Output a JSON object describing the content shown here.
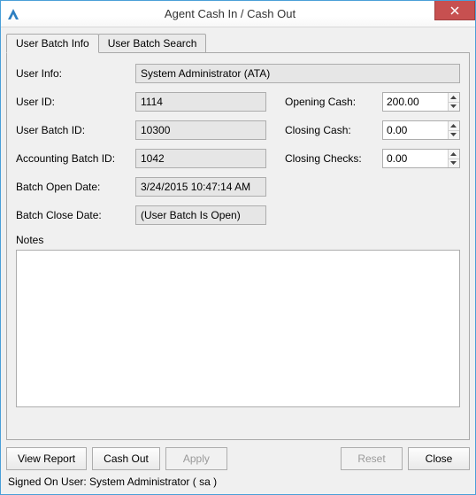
{
  "window": {
    "title": "Agent Cash In / Cash Out"
  },
  "tabs": {
    "info": "User Batch Info",
    "search": "User Batch Search"
  },
  "labels": {
    "userInfo": "User Info:",
    "userId": "User ID:",
    "userBatchId": "User Batch ID:",
    "acctBatchId": "Accounting Batch ID:",
    "batchOpen": "Batch Open Date:",
    "batchClose": "Batch Close Date:",
    "openingCash": "Opening Cash:",
    "closingCash": "Closing Cash:",
    "closingChecks": "Closing Checks:",
    "notes": "Notes"
  },
  "values": {
    "userInfo": "System Administrator (ATA)",
    "userId": "1114",
    "userBatchId": "10300",
    "acctBatchId": "1042",
    "batchOpen": "3/24/2015 10:47:14 AM",
    "batchClose": "(User Batch Is Open)",
    "openingCash": "200.00",
    "closingCash": "0.00",
    "closingChecks": "0.00",
    "notes": ""
  },
  "buttons": {
    "viewReport": "View Report",
    "cashOut": "Cash Out",
    "apply": "Apply",
    "reset": "Reset",
    "close": "Close"
  },
  "status": "Signed On User: System Administrator ( sa )"
}
